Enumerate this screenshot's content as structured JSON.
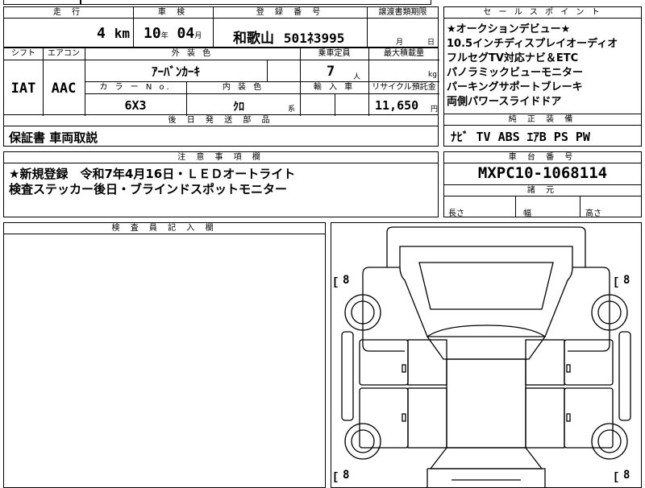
{
  "headers": {
    "mileage": "走 行",
    "inspection": "車 検",
    "registration": "登 録 番 号",
    "transfer_deadline": "譲渡書類期限",
    "shift": "シフト",
    "aircon": "エアコン",
    "exterior_color": "外 装 色",
    "capacity": "乗車定員",
    "max_load": "最大積載量",
    "color_no": "カ ラ ー N o.",
    "interior_color": "内 装 色",
    "import": "輸 入 車",
    "recycle_fee": "リサイクル預託金",
    "later_parts": "後 日 発 送 部 品",
    "selling_points": "セ ー ル ス ポ イ ン ト",
    "genuine_equipment": "純 正 装 備",
    "notes": "注 意 事 項 欄",
    "chassis_number": "車 台 番 号",
    "specs": "諸 元",
    "inspector": "検 査 員 記 入 欄"
  },
  "values": {
    "mileage": "4",
    "mileage_unit": "km",
    "insp_year": "10",
    "insp_year_unit": "年",
    "insp_month": "04",
    "insp_month_unit": "月",
    "reg_area": "和歌山",
    "reg_number": "501ﾈ3995",
    "transfer_month_unit": "月",
    "transfer_day_unit": "日",
    "shift": "IAT",
    "aircon": "AAC",
    "exterior_color": "ｱｰﾊﾞﾝｶｰｷ",
    "capacity": "7",
    "capacity_unit": "人",
    "load_unit": "kg",
    "color_no": "6X3",
    "interior_color": "ｸﾛ",
    "interior_unit": "系",
    "recycle_fee": "11,650",
    "recycle_unit": "円",
    "later_parts": "保証書 車両取説",
    "genuine_equipment": "ﾅﾋﾞ TV ABS ｴｱB PS PW",
    "chassis_number": "MXPC10-1068114",
    "spec_length": "長さ",
    "spec_width": "幅",
    "spec_height": "高さ"
  },
  "selling_points": [
    "★オークションデビュー★",
    "10.5インチディスプレイオーディオ",
    "フルセグTV対応ナビ＆ETC",
    "パノラミックビューモニター",
    "パーキングサポートブレーキ",
    "両側パワースライドドア"
  ],
  "notes": [
    "★新規登録　令和7年4月16日・ＬＥＤオートライト",
    "検査ステッカー後日・ブラインドスポットモニター"
  ],
  "diagram": {
    "tire_label": "8",
    "tire_labels_count": 4
  }
}
